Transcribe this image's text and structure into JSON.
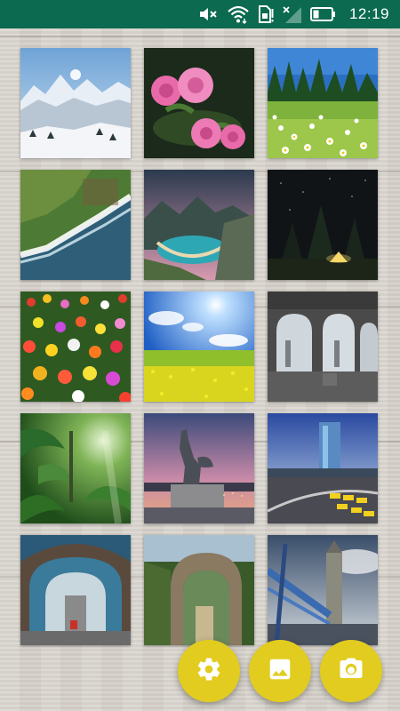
{
  "status_bar": {
    "time": "12:19",
    "background_color": "#0b6a4f",
    "icons": [
      "mute-icon",
      "wifi-icon",
      "sim-alert-icon",
      "signal-off-icon",
      "battery-icon"
    ]
  },
  "gallery": {
    "tiles": [
      {
        "subject": "snowy-mountains",
        "icon": "photo-thumbnail"
      },
      {
        "subject": "pink-roses",
        "icon": "photo-thumbnail"
      },
      {
        "subject": "daisy-meadow",
        "icon": "photo-thumbnail"
      },
      {
        "subject": "coastal-cliffs",
        "icon": "photo-thumbnail"
      },
      {
        "subject": "mountain-bay",
        "icon": "photo-thumbnail"
      },
      {
        "subject": "night-tent",
        "icon": "photo-thumbnail"
      },
      {
        "subject": "flower-field",
        "icon": "photo-thumbnail"
      },
      {
        "subject": "sunny-meadow",
        "icon": "photo-thumbnail"
      },
      {
        "subject": "arched-hall",
        "icon": "photo-thumbnail"
      },
      {
        "subject": "jungle",
        "icon": "photo-thumbnail"
      },
      {
        "subject": "statue-sunset",
        "icon": "photo-thumbnail"
      },
      {
        "subject": "city-tower",
        "icon": "photo-thumbnail"
      },
      {
        "subject": "bridge-interior",
        "icon": "photo-thumbnail"
      },
      {
        "subject": "stone-arch",
        "icon": "photo-thumbnail"
      },
      {
        "subject": "tower-bridge",
        "icon": "photo-thumbnail"
      }
    ]
  },
  "fabs": {
    "accent_color": "#e2cc1f",
    "settings": {
      "icon": "gear-icon"
    },
    "gallery": {
      "icon": "image-icon"
    },
    "camera": {
      "icon": "camera-icon"
    }
  }
}
